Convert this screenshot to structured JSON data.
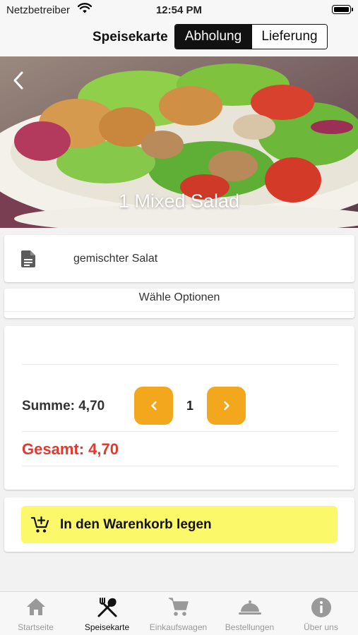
{
  "status_bar": {
    "carrier": "Netzbetreiber",
    "time": "12:54 PM"
  },
  "nav": {
    "title": "Speisekarte",
    "segments": [
      {
        "label": "Abholung",
        "selected": true
      },
      {
        "label": "Lieferung",
        "selected": false
      }
    ]
  },
  "hero": {
    "title": "1 Mixed Salad"
  },
  "description": {
    "icon": "document-icon",
    "text": "gemischter Salat"
  },
  "options": {
    "label": "Wähle Optionen"
  },
  "totals": {
    "sum_label": "Summe: 4,70",
    "quantity": "1",
    "grand_label": "Gesamt: 4,70"
  },
  "cart": {
    "icon": "cart-add-icon",
    "label": "In den Warenkorb legen"
  },
  "colors": {
    "accent_orange": "#f3a71d",
    "cart_yellow": "#fbf96a",
    "total_red": "#e03a30"
  },
  "tabs": [
    {
      "label": "Startseite",
      "icon": "home-icon",
      "active": false
    },
    {
      "label": "Speisekarte",
      "icon": "utensils-icon",
      "active": true
    },
    {
      "label": "Einkaufswagen",
      "icon": "cart-icon",
      "active": false
    },
    {
      "label": "Bestellungen",
      "icon": "cloche-icon",
      "active": false
    },
    {
      "label": "Über uns",
      "icon": "info-icon",
      "active": false
    }
  ]
}
